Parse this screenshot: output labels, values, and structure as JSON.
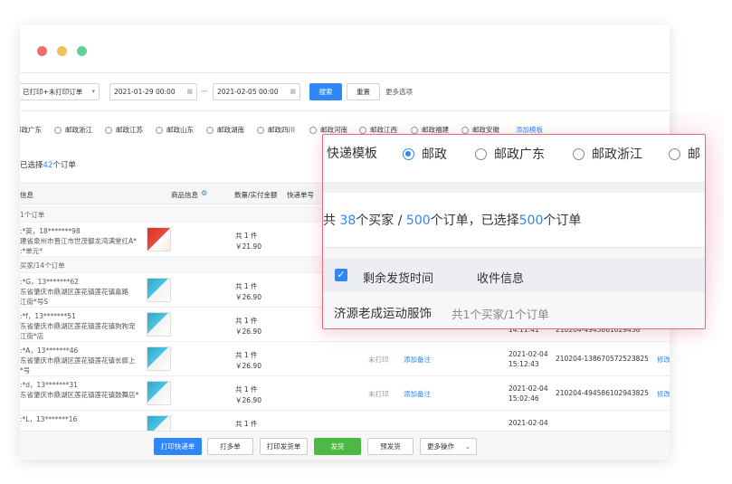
{
  "toolbar": {
    "print_status": "已打印+未打印订单",
    "date_start": "2021-01-29 00:00",
    "date_sep": "—",
    "date_end": "2021-02-05 00:00",
    "search": "搜索",
    "reset": "重置",
    "more_options": "更多选项"
  },
  "templates": [
    "邮政广东",
    "邮政浙江",
    "邮政江苏",
    "邮政山东",
    "邮政湖南",
    "邮政四川",
    "邮政河南",
    "邮政江西",
    "邮政福建",
    "邮政安徽"
  ],
  "add_template": "添加模板",
  "selected": {
    "prefix": "已选择",
    "count": "42",
    "suffix": "个订单"
  },
  "table_header": {
    "info": "信息",
    "goods": "商品信息",
    "qty": "数量/实付金额",
    "tracking": "快递单号"
  },
  "groups": [
    {
      "title": "1个订单",
      "rows": [
        {
          "line1": ":*英，18*******98",
          "line2": "建省泉州市晋江市世茂御龙湾满堂红A*",
          "line3": ":*单元*",
          "qty": "共 1 件",
          "amount": "￥21.90"
        }
      ]
    },
    {
      "title": "买家/14个订单",
      "rows": [
        {
          "line1": ":*G，13*******62",
          "line2": "东省肇庆市鼎湖区莲花镇莲花镇嘉路",
          "line3": "江街*号S",
          "qty": "共 1 件",
          "amount": "￥26.90"
        },
        {
          "line1": ":*f，13*******51",
          "line2": "东省肇庆市鼎湖区莲花镇莲花镇狗狗宠",
          "line3": "江街*店",
          "qty": "共 1 件",
          "amount": "￥26.90",
          "time": "14:11:41"
        },
        {
          "line1": ":*A，13*******46",
          "line2": "东省肇庆市鼎湖区莲花镇莲花镇长廊上",
          "line3": "*号",
          "qty": "共 1 件",
          "amount": "￥26.90",
          "status": "未打印",
          "note": "添加备注",
          "date": "2021-02-04",
          "time": "15:12:43",
          "order": "210204-138670572523825",
          "edit": "修改"
        },
        {
          "line1": ":*d，13*******31",
          "line2": "东省肇庆市鼎湖区莲花镇莲花镇鼓舞店*",
          "line3": "",
          "qty": "共 1 件",
          "amount": "￥26.90",
          "status": "未打印",
          "note": "添加备注",
          "date": "2021-02-04",
          "time": "15:02:46",
          "order": "210204-494586102943825",
          "edit": "修改"
        },
        {
          "line1": ":*L，13*******16",
          "line2": "",
          "line3": "",
          "qty": "共 1 件",
          "amount": "",
          "date": "2021-02-04"
        }
      ]
    }
  ],
  "partial_order_2": "210204-4945861029438",
  "bottom": {
    "print_express": "打印快递单",
    "multi": "打多单",
    "print_ship": "打印发货单",
    "ship": "发货",
    "pre_ship": "预发货",
    "more": "更多操作"
  },
  "callout": {
    "label": "快递模板",
    "options": [
      "邮政",
      "邮政广东",
      "邮政浙江",
      "邮"
    ],
    "summary_prefix": "共",
    "buyers": "38",
    "summary_mid": "个买家 /",
    "orders": "500",
    "summary_mid2": "个订单，已选择",
    "selected": "500",
    "summary_suffix": "个订单",
    "col_time": "剩余发货时间",
    "col_info": "收件信息",
    "shop": "济源老成运动服饰",
    "shop_stat": "共1个买家/1个订单"
  },
  "colors": {
    "primary": "#2f86f6",
    "success": "#4cb944",
    "highlight": "#e46b7e"
  }
}
